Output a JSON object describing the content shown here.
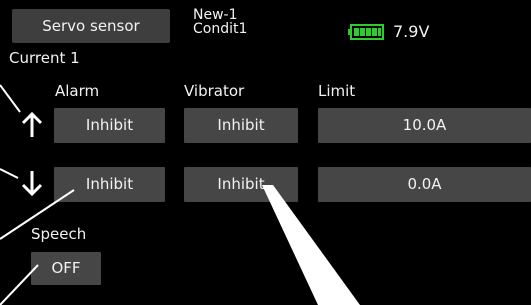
{
  "header": {
    "tab_title": "Servo sensor",
    "model_name": "New-1",
    "condition_name": "Condit1",
    "battery_voltage": "7.9V",
    "battery_icon": "battery-full-icon",
    "battery_color": "#2ecc2e"
  },
  "section": {
    "title": "Current 1"
  },
  "columns": {
    "alarm": "Alarm",
    "vibrator": "Vibrator",
    "limit": "Limit"
  },
  "rows": [
    {
      "direction_icon": "arrow-up-icon",
      "alarm": "Inhibit",
      "vibrator": "Inhibit",
      "limit": "10.0A"
    },
    {
      "direction_icon": "arrow-down-icon",
      "alarm": "Inhibit",
      "vibrator": "Inhibit",
      "limit": "0.0A"
    }
  ],
  "speech": {
    "label": "Speech",
    "value": "OFF"
  },
  "colors": {
    "background": "#000000",
    "button": "#464646",
    "tab": "#3e3e3e",
    "text": "#f2f2f2"
  }
}
